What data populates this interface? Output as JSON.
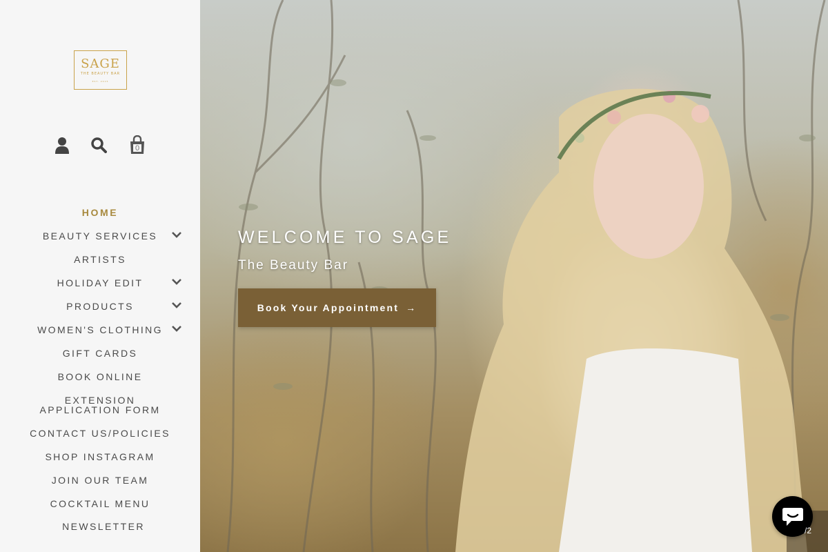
{
  "brand": {
    "logo_main": "SAGE",
    "logo_sub": "THE BEAUTY BAR",
    "logo_small": "EST. 2015",
    "gold": "#c9a24a"
  },
  "header_icons": {
    "account": "account-icon",
    "search": "search-icon",
    "cart": "cart-icon",
    "cart_count": "0"
  },
  "nav": {
    "items": [
      {
        "label": "HOME",
        "active": true,
        "has_submenu": false
      },
      {
        "label": "BEAUTY SERVICES",
        "has_submenu": true
      },
      {
        "label": "ARTISTS",
        "has_submenu": false
      },
      {
        "label": "HOLIDAY EDIT",
        "has_submenu": true
      },
      {
        "label": "PRODUCTS",
        "has_submenu": true
      },
      {
        "label": "WOMEN'S CLOTHING",
        "has_submenu": true
      },
      {
        "label": "GIFT CARDS",
        "has_submenu": false
      },
      {
        "label": "BOOK ONLINE",
        "has_submenu": false
      },
      {
        "label": "EXTENSION APPLICATION FORM",
        "has_submenu": false
      },
      {
        "label": "CONTACT US/POLICIES",
        "has_submenu": false
      },
      {
        "label": "SHOP INSTAGRAM",
        "has_submenu": false
      },
      {
        "label": "JOIN OUR TEAM",
        "has_submenu": false
      },
      {
        "label": "COCKTAIL MENU",
        "has_submenu": false
      },
      {
        "label": "NEWSLETTER",
        "has_submenu": false
      }
    ],
    "active_color": "#a88a3f"
  },
  "hero": {
    "title": "WELCOME TO SAGE",
    "subtitle": "The Beauty Bar",
    "button_label": "Book Your Appointment",
    "button_arrow": "→",
    "button_color": "#7a6036"
  },
  "chat": {
    "icon": "chat-icon",
    "corner_text": "/2"
  }
}
